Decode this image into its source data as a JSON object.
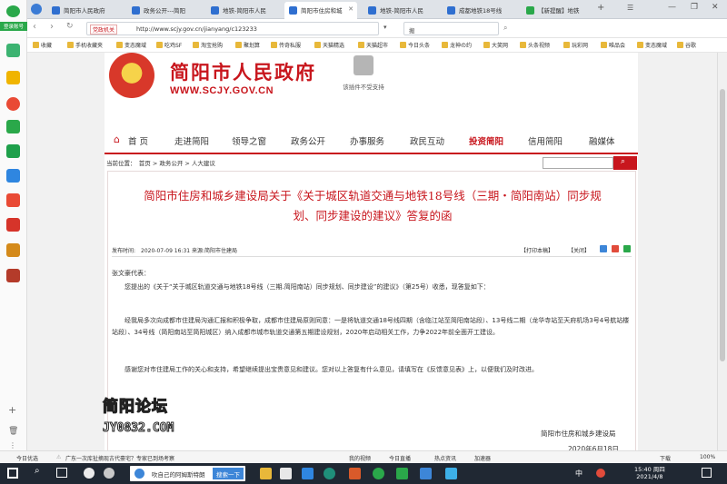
{
  "browser": {
    "tabs": [
      {
        "label": "简阳市人民政府",
        "active": false
      },
      {
        "label": "政务公开---简阳",
        "active": false
      },
      {
        "label": "地铁-简阳市人民",
        "active": false
      },
      {
        "label": "简阳市住房和城",
        "active": true
      },
      {
        "label": "地铁-简阳市人民",
        "active": false
      },
      {
        "label": "成都地铁18号线",
        "active": false
      },
      {
        "label": "【新提醒】地铁",
        "active": false
      }
    ],
    "sidebar_label": "登录账号",
    "url_badge": "党政机关",
    "url": "http://www.scjy.gov.cn/jianyang/c123233",
    "search_value": "搬",
    "bookmarks": [
      "收藏",
      "手机收藏夹",
      "变态魔域",
      "吃鸡SF",
      "淘宝抢购",
      "聚划算",
      "传奇私服",
      "天猫精选",
      "天猫超市",
      "今日头条",
      "龙神の约",
      "大笑网",
      "头条视频",
      "玩彩网",
      "唯品会",
      "变态魔域",
      "谷歌"
    ]
  },
  "site": {
    "name": "简阳市人民政府",
    "url_text": "WWW.SCJY.GOV.CN",
    "plugin_notice": "该插件不受支持",
    "nav": [
      {
        "label": "首 页",
        "hot": false
      },
      {
        "label": "走进简阳",
        "hot": false
      },
      {
        "label": "领导之窗",
        "hot": false
      },
      {
        "label": "政务公开",
        "hot": false
      },
      {
        "label": "办事服务",
        "hot": false
      },
      {
        "label": "政民互动",
        "hot": false
      },
      {
        "label": "投资简阳",
        "hot": true
      },
      {
        "label": "信用简阳",
        "hot": false
      },
      {
        "label": "融媒体",
        "hot": false
      }
    ],
    "breadcrumb": "当前位置：　首页 > 政务公开 > 人大建议"
  },
  "article": {
    "title_line1": "简阳市住房和城乡建设局关于《关于城区轨道交通与地铁18号线（三期・简阳南站）同步规",
    "title_line2": "划、同步建设的建议》答复的函",
    "meta_left": "发布时间:　2020-07-09 16:31 来源:简阳市住建局",
    "meta_print": "【打印本稿】",
    "meta_close": "【关闭】",
    "greeting": "张文豪代表：",
    "para1": "　　您提出的《关于“关于城区轨道交通与地铁18号线（三期.简阳南站）同步规划、同步建设”的建议》（第25号）收悉，现答复如下：",
    "para2": "　　经我局多次向成都市住建局沟通汇报和积极争取，成都市住建局原则同意：一是将轨道交通18号线四期（含临江站至简阳南站段）、13号线二期（龙华寺站至天府机场3号4号航站楼站段）、34号线（简阳南站至简阳城区）纳入成都市城市轨道交通第五期建设规划，2020年启动相关工作，力争2022年前全面开工建设。",
    "para3": "　　感谢您对市住建局工作的关心和支持，希望继续提出宝贵意见和建议。您对以上答复有什么意见，请填写在《反馈意见表》上，以便我们及时改进。",
    "signature": "简阳市住房和城乡建设局",
    "date": "2020年6月18日"
  },
  "watermark": {
    "line1": "简阳论坛",
    "line2": "JY0832.COM"
  },
  "status": {
    "left1": "今日优选",
    "news": "广东一次库扯摘现古代豪宅？专家已到场考察",
    "video": "我的视频",
    "live": "今日直播",
    "hot": "热点资讯",
    "accel": "加速器",
    "download": "下载",
    "zoom": "100%"
  },
  "taskbar": {
    "search_text": "吹自己的阿姆斯特朗",
    "search_btn": "搜索一下",
    "ime": "中",
    "time": "15:40 周四",
    "date": "2021/4/8"
  },
  "colors": {
    "brand_red": "#c8161d",
    "taskbar": "#202833"
  }
}
